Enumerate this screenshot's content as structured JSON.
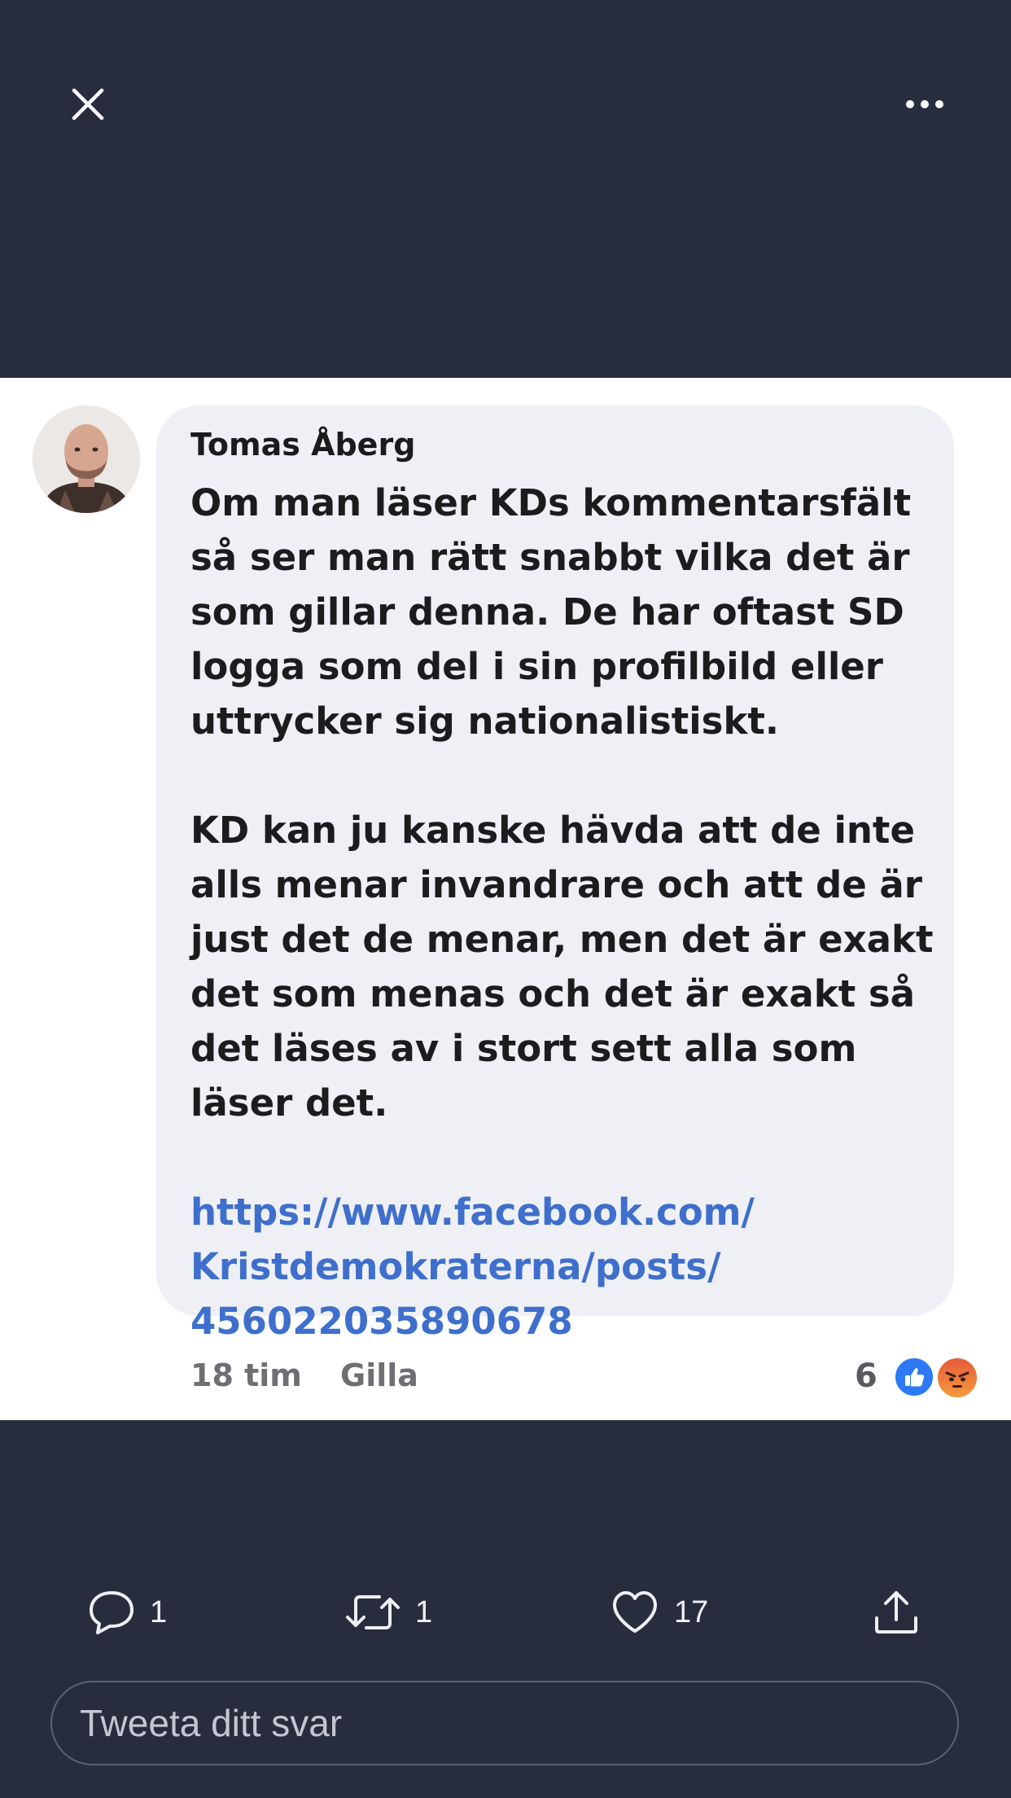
{
  "post": {
    "author": "Tomas Åberg",
    "paragraphs": [
      "Om man läser KDs kommentarsfält så ser man rätt snabbt vilka det är som gillar denna. De har oftast SD logga som del i sin profilbild eller uttrycker sig nationalistiskt.",
      "KD kan ju kanske hävda att de inte alls menar invandrare och att de är just det de menar, men det är exakt det som menas och det är exakt så det läses av i stort sett alla som läser det."
    ],
    "link": "https://www.facebook.com/\nKristdemokraterna/posts/\n456022035890678",
    "time": "18 tim",
    "like_label": "Gilla",
    "reaction_count": "6"
  },
  "actions": {
    "reply_count": "1",
    "retweet_count": "1",
    "like_count": "17"
  },
  "reply_input": {
    "placeholder": "Tweeta ditt svar"
  },
  "icons": {
    "close": "close-icon",
    "more": "more-icon",
    "reply": "reply-icon",
    "retweet": "retweet-icon",
    "like": "heart-icon",
    "share": "share-icon"
  },
  "colors": {
    "background": "#282d3e",
    "link": "#3f6fcc",
    "like_reaction": "#2d79f5"
  }
}
